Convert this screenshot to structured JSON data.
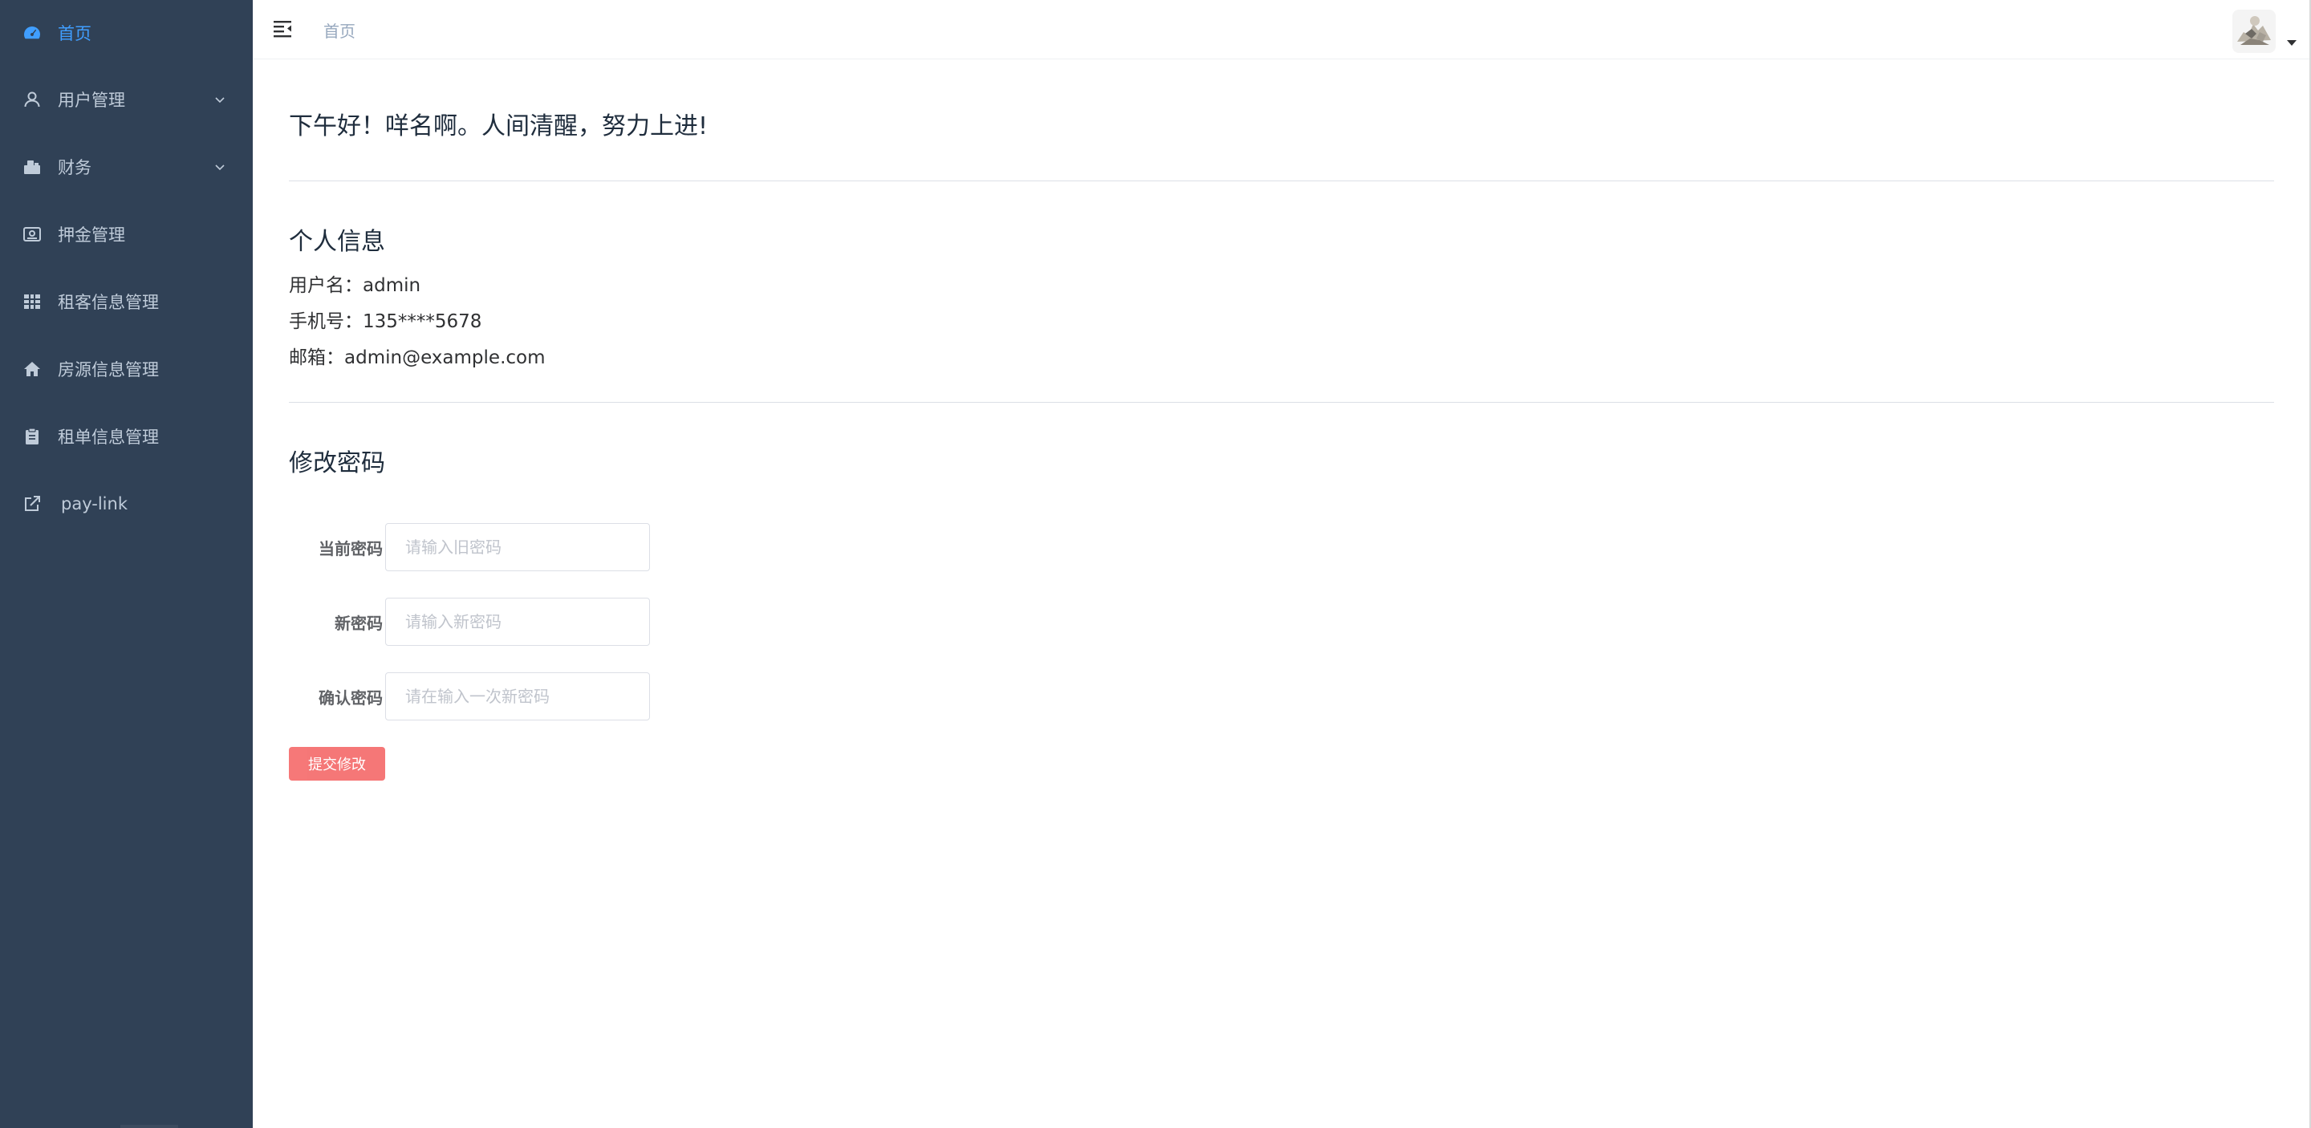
{
  "sidebar": {
    "items": [
      {
        "label": "首页",
        "icon": "dashboard-icon",
        "active": true
      },
      {
        "label": "用户管理",
        "icon": "user-icon",
        "has_children": true
      },
      {
        "label": "财务",
        "icon": "finance-icon",
        "has_children": true
      },
      {
        "label": "押金管理",
        "icon": "deposit-icon"
      },
      {
        "label": "租客信息管理",
        "icon": "table-icon"
      },
      {
        "label": "房源信息管理",
        "icon": "home-icon"
      },
      {
        "label": "租单信息管理",
        "icon": "clipboard-icon"
      },
      {
        "label": "pay-link",
        "icon": "external-link-icon"
      }
    ]
  },
  "header": {
    "breadcrumb": "首页"
  },
  "main": {
    "greeting": "下午好！咩名啊。人间清醒，努力上进!",
    "profile": {
      "title": "个人信息",
      "username": "用户名：admin",
      "phone": "手机号：135****5678",
      "email": "邮箱：admin@example.com"
    },
    "password_form": {
      "title": "修改密码",
      "current_label": "当前密码",
      "current_placeholder": "请输入旧密码",
      "new_label": "新密码",
      "new_placeholder": "请输入新密码",
      "confirm_label": "确认密码",
      "confirm_placeholder": "请在输入一次新密码",
      "submit_label": "提交修改"
    }
  },
  "colors": {
    "sidebar_bg": "#304156",
    "sidebar_text": "#bfcbd9",
    "active": "#409eff",
    "submit_button": "#f56c6c"
  }
}
